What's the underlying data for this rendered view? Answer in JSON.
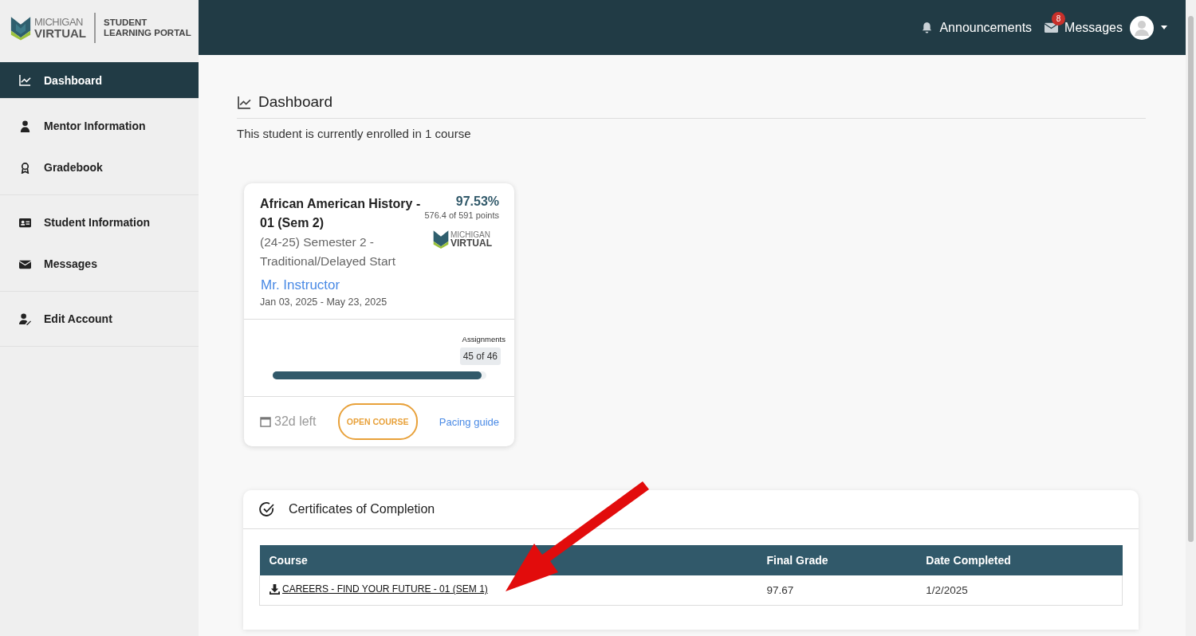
{
  "logo": {
    "brand_top": "MICHIGAN",
    "brand_bottom": "VIRTUAL",
    "portal_top": "STUDENT",
    "portal_bottom": "LEARNING PORTAL"
  },
  "header": {
    "announcements": "Announcements",
    "messages": "Messages",
    "message_count": "8"
  },
  "sidebar": {
    "groups": [
      [
        {
          "label": "Dashboard",
          "selected": true
        }
      ],
      [
        {
          "label": "Mentor Information",
          "selected": false
        },
        {
          "label": "Gradebook",
          "selected": false
        }
      ],
      [
        {
          "label": "Student Information",
          "selected": false
        },
        {
          "label": "Messages",
          "selected": false
        }
      ],
      [
        {
          "label": "Edit Account",
          "selected": false
        }
      ]
    ]
  },
  "page": {
    "title": "Dashboard",
    "subtitle": "This student is currently enrolled in 1 course"
  },
  "course_card": {
    "title": "African American History - 01 (Sem 2)",
    "term": "(24-25) Semester 2 - Traditional/Delayed Start",
    "grade": "97.53%",
    "points": "576.4 of 591 points",
    "logo_top": "MICHIGAN",
    "logo_bottom": "VIRTUAL",
    "instructor": "Mr. Instructor",
    "dates": "Jan 03, 2025 - May 23, 2025",
    "progress_label": "Assignments",
    "progress_reading": "45 of 46",
    "level": 0.978,
    "days_left": "32d left",
    "open_button": "OPEN COURSE",
    "pacing_link": "Pacing guide"
  },
  "certificates": {
    "title": "Certificates of Completion",
    "columns": [
      "Course",
      "Final Grade",
      "Date Completed"
    ],
    "rows": [
      {
        "course": "CAREERS - FIND YOUR FUTURE - 01 (SEM 1)",
        "final_grade": "97.67",
        "date_completed": "1/2/2025"
      }
    ]
  },
  "annotation": {
    "kind": "arrow"
  }
}
